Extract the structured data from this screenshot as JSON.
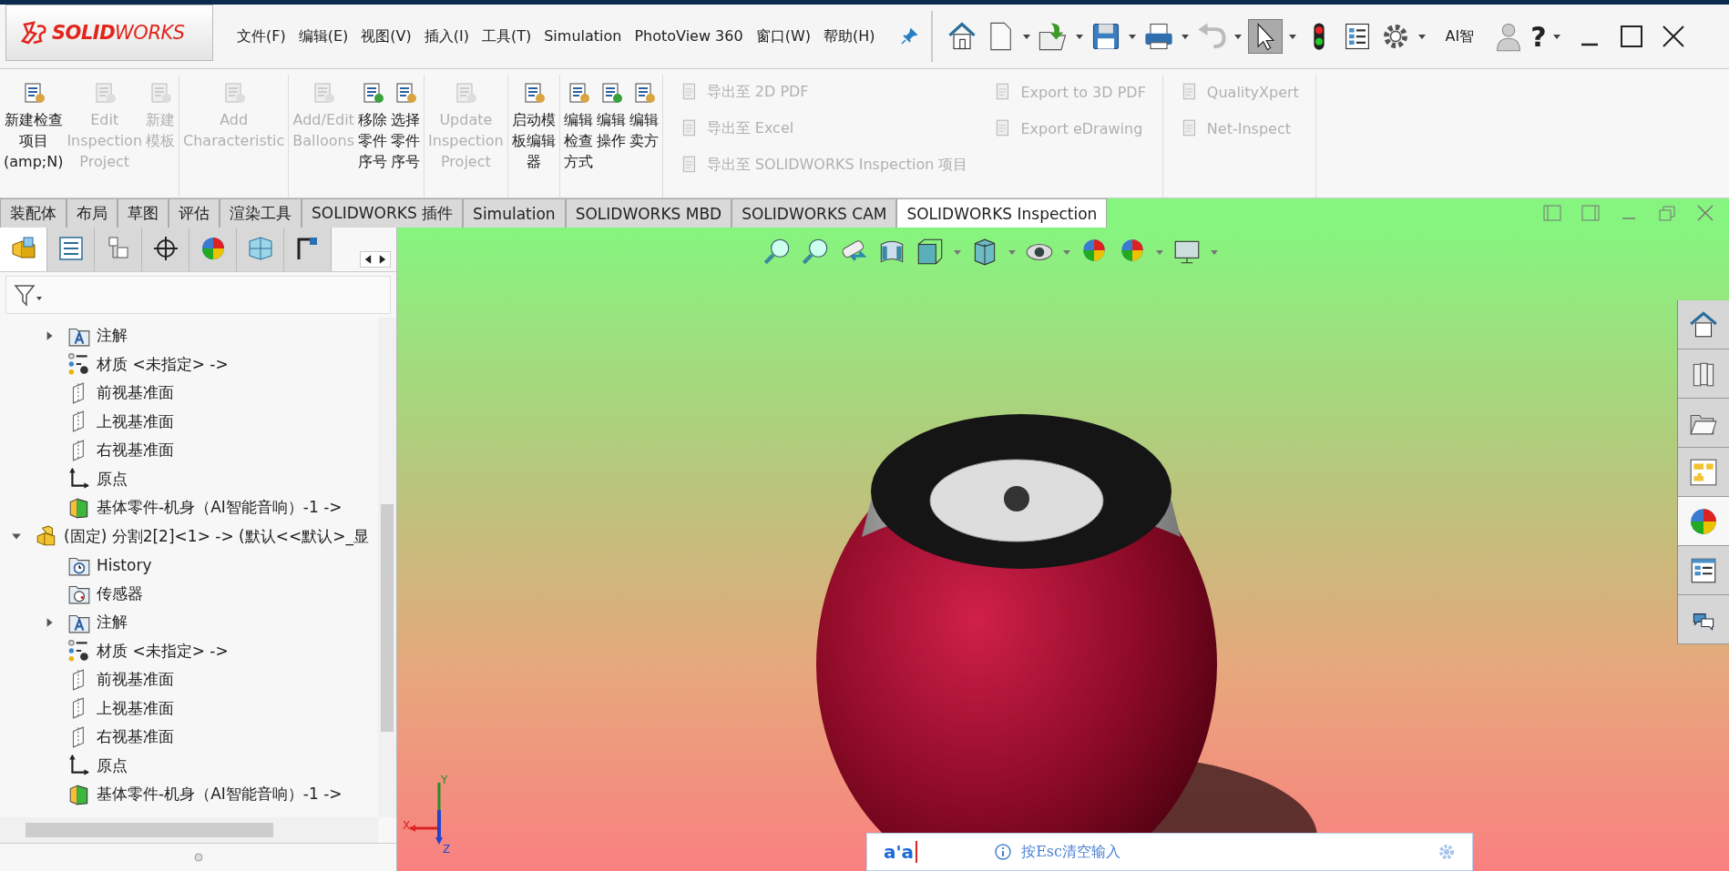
{
  "logo": {
    "wordmark": "**SOLID**WORKS"
  },
  "menu": [
    "文件(F)",
    "编辑(E)",
    "视图(V)",
    "插入(I)",
    "工具(T)",
    "Simulation",
    "PhotoView 360",
    "窗口(W)",
    "帮助(H)"
  ],
  "quick_toolbar": {
    "ai_label": "AI智",
    "help_label": "?"
  },
  "ribbon": {
    "groups": [
      {
        "kind": "large",
        "buttons": [
          {
            "label": "新建检查项目(amp;N)",
            "disabled": false
          },
          {
            "label": "Edit Inspection Project",
            "disabled": true
          },
          {
            "label": "新建模板",
            "disabled": true
          }
        ]
      },
      {
        "kind": "large",
        "buttons": [
          {
            "label": "Add Characteristic",
            "disabled": true
          }
        ]
      },
      {
        "kind": "large",
        "buttons": [
          {
            "label": "Add/Edit Balloons",
            "disabled": true
          },
          {
            "label": "移除零件序号",
            "disabled": false
          },
          {
            "label": "选择零件序号",
            "disabled": false
          }
        ]
      },
      {
        "kind": "large",
        "buttons": [
          {
            "label": "Update Inspection Project",
            "disabled": true
          }
        ]
      },
      {
        "kind": "large",
        "buttons": [
          {
            "label": "启动模板编辑器",
            "disabled": false
          }
        ]
      },
      {
        "kind": "large",
        "buttons": [
          {
            "label": "编辑检查方式",
            "disabled": false
          },
          {
            "label": "编辑操作",
            "disabled": false
          },
          {
            "label": "编辑卖方",
            "disabled": false
          }
        ]
      },
      {
        "kind": "small",
        "columns": [
          [
            {
              "label": "导出至 2D PDF",
              "disabled": true
            },
            {
              "label": "导出至 Excel",
              "disabled": true
            },
            {
              "label": "导出至 SOLIDWORKS Inspection 项目",
              "disabled": true
            }
          ],
          [
            {
              "label": "Export to 3D PDF",
              "disabled": true
            },
            {
              "label": "Export eDrawing",
              "disabled": true
            }
          ]
        ]
      },
      {
        "kind": "small",
        "columns": [
          [
            {
              "label": "QualityXpert",
              "disabled": true
            },
            {
              "label": "Net-Inspect",
              "disabled": true
            }
          ]
        ]
      }
    ]
  },
  "tabs": [
    {
      "label": "装配体",
      "selected": false
    },
    {
      "label": "布局",
      "selected": false
    },
    {
      "label": "草图",
      "selected": false
    },
    {
      "label": "评估",
      "selected": false
    },
    {
      "label": "渲染工具",
      "selected": false
    },
    {
      "label": "SOLIDWORKS 插件",
      "selected": false
    },
    {
      "label": "Simulation",
      "selected": false
    },
    {
      "label": "SOLIDWORKS MBD",
      "selected": false
    },
    {
      "label": "SOLIDWORKS CAM",
      "selected": false
    },
    {
      "label": "SOLIDWORKS Inspection",
      "selected": true
    }
  ],
  "panel_tabs": [
    {
      "selected": true
    },
    {
      "selected": false
    },
    {
      "selected": false
    },
    {
      "selected": false
    },
    {
      "selected": false
    },
    {
      "selected": false
    },
    {
      "selected": false
    }
  ],
  "tree": {
    "continued_children": [
      {
        "kind": "annotation",
        "label": "注解",
        "expanded": false
      },
      {
        "kind": "material",
        "label": "材质 <未指定> ->"
      },
      {
        "kind": "plane",
        "label": "前视基准面"
      },
      {
        "kind": "plane",
        "label": "上视基准面"
      },
      {
        "kind": "plane",
        "label": "右视基准面"
      },
      {
        "kind": "origin",
        "label": "原点"
      },
      {
        "kind": "part",
        "label": "基体零件-机身（AI智能音响）-1 ->"
      }
    ],
    "items": [
      {
        "kind": "assembly",
        "label": "(固定) 分割2[2]<1> -> (默认<<默认>_显",
        "expanded": true,
        "children": [
          {
            "kind": "history",
            "label": "History"
          },
          {
            "kind": "sensor",
            "label": "传感器"
          },
          {
            "kind": "annotation",
            "label": "注解",
            "expanded": false
          },
          {
            "kind": "material",
            "label": "材质 <未指定> ->"
          },
          {
            "kind": "plane",
            "label": "前视基准面"
          },
          {
            "kind": "plane",
            "label": "上视基准面"
          },
          {
            "kind": "plane",
            "label": "右视基准面"
          },
          {
            "kind": "origin",
            "label": "原点"
          },
          {
            "kind": "part",
            "label": "基体零件-机身（AI智能音响）-1 ->"
          }
        ]
      }
    ]
  },
  "task_pane": [
    {
      "selected": false
    },
    {
      "selected": false
    },
    {
      "selected": false
    },
    {
      "selected": false
    },
    {
      "selected": true
    },
    {
      "selected": false
    },
    {
      "selected": false
    }
  ],
  "triad": {
    "x": "X",
    "y": "Y",
    "z": "Z"
  },
  "ime": {
    "value": "a'a",
    "hint": "按Esc清空输入"
  }
}
